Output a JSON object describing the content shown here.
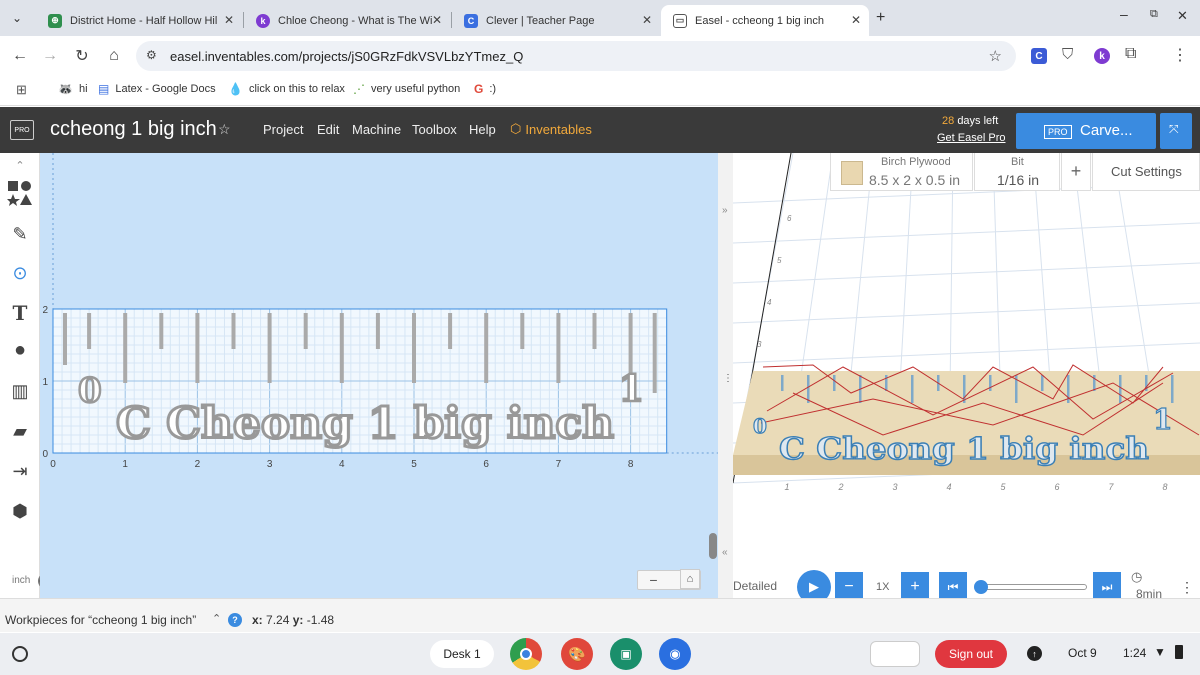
{
  "browser": {
    "tabs": [
      {
        "label": "District Home - Half Hollow Hil",
        "favicon_color": "#2f8f4e",
        "favicon_char": "⊕"
      },
      {
        "label": "Chloe Cheong - What is The Wi",
        "favicon_color": "#7e3bd1",
        "favicon_char": "k"
      },
      {
        "label": "Clever | Teacher Page",
        "favicon_color": "#3b6fe0",
        "favicon_char": "C"
      },
      {
        "label": "Easel - ccheong 1 big inch",
        "favicon_color": "#555555",
        "favicon_char": "▭"
      }
    ],
    "url": "easel.inventables.com/projects/jS0GRzFdkVSVLbzYTmez_Q",
    "bookmarks": [
      {
        "label": "hi",
        "icon": "🦝"
      },
      {
        "label": "Latex - Google Docs",
        "icon": "▤"
      },
      {
        "label": "click on this to relax",
        "icon": "💧"
      },
      {
        "label": "very useful python",
        "icon": "⋰"
      },
      {
        "label": ":)",
        "icon": "G"
      }
    ]
  },
  "easel": {
    "pro_badge": "PRO",
    "project_title": "ccheong 1 big inch",
    "menu": [
      "Project",
      "Edit",
      "Machine",
      "Toolbox",
      "Help"
    ],
    "inventables": "Inventables",
    "trial_days": "28",
    "trial_text": "days left",
    "get_pro": "Get Easel Pro",
    "carve_pro": "PRO",
    "carve_label": "Carve..."
  },
  "canvas": {
    "x_ticks": [
      "0",
      "1",
      "2",
      "3",
      "4",
      "5",
      "6",
      "7",
      "8"
    ],
    "y_ticks": [
      "0",
      "1",
      "2"
    ],
    "text_label": "C Cheong 1 big inch",
    "zero_label": "0",
    "one_label": "1",
    "unit_left": "inch",
    "unit_right": "mm"
  },
  "preview": {
    "material_name": "Birch Plywood",
    "material_size": "8.5 x 2 x 0.5 in",
    "bit_label": "Bit",
    "bit_value": "1/16 in",
    "cut_settings": "Cut Settings",
    "x_ticks": [
      "1",
      "2",
      "3",
      "4",
      "5",
      "6",
      "7",
      "8"
    ],
    "y_ticks": [
      "3",
      "4",
      "5",
      "6"
    ],
    "detailed": "Detailed",
    "speed": "1X",
    "time": "8min",
    "progress": 0
  },
  "status": {
    "workpieces": "Workpieces for “ccheong 1 big inch”",
    "coord_x_label": "x:",
    "coord_x": "7.24",
    "coord_y_label": "y:",
    "coord_y": "-1.48"
  },
  "shelf": {
    "desk": "Desk 1",
    "sign_out": "Sign out",
    "date": "Oct 9",
    "time": "1:24"
  }
}
